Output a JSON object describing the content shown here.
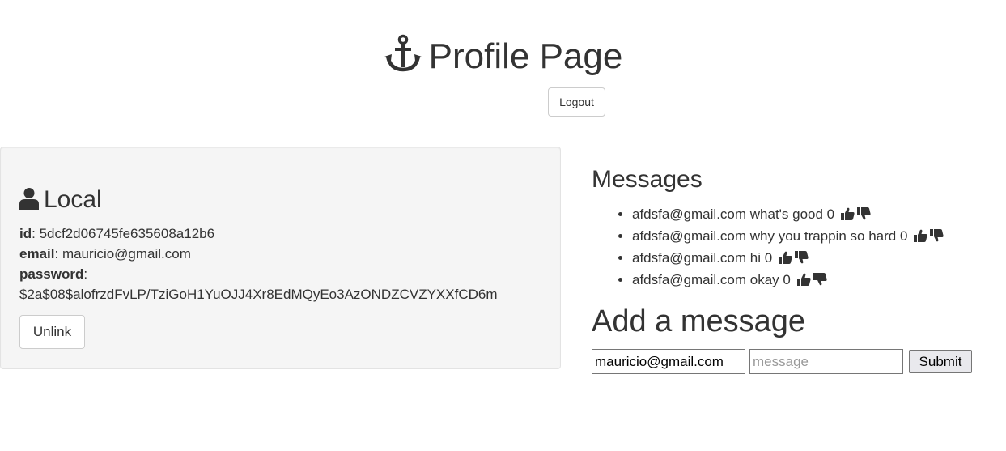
{
  "header": {
    "title": "Profile Page",
    "title_icon": "anchor-icon",
    "logout_label": "Logout"
  },
  "local": {
    "heading": "Local",
    "heading_icon": "user-icon",
    "id_label": "id",
    "id_value": "5dcf2d06745fe635608a12b6",
    "email_label": "email",
    "email_value": "mauricio@gmail.com",
    "password_label": "password",
    "password_value": "$2a$08$alofrzdFvLP/TziGoH1YuOJJ4Xr8EdMQyEo3AzONDZCVZYXXfCD6m",
    "unlink_label": "Unlink"
  },
  "messages": {
    "heading": "Messages",
    "items": [
      {
        "text": "afdsfa@gmail.com what's good 0"
      },
      {
        "text": "afdsfa@gmail.com why you trappin so hard 0"
      },
      {
        "text": "afdsfa@gmail.com hi 0"
      },
      {
        "text": "afdsfa@gmail.com okay 0"
      }
    ],
    "vote_icons": [
      "thumbs-up-icon",
      "thumbs-down-icon"
    ]
  },
  "add_message": {
    "heading": "Add a message",
    "name_value": "mauricio@gmail.com",
    "message_placeholder": "message",
    "submit_label": "Submit"
  },
  "colors": {
    "text": "#333333",
    "well_background": "#f5f5f5",
    "border": "#cccccc"
  }
}
